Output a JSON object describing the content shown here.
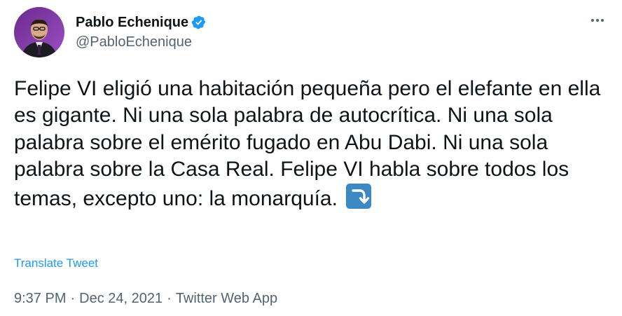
{
  "author": {
    "display_name": "Pablo Echenique",
    "handle": "@PabloEchenique",
    "verified": true,
    "avatar_icon": "profile-photo"
  },
  "tweet": {
    "text": "Felipe VI eligió una habitación pequeña pero el elefante en ella es gigante. Ni una sola palabra de autocrítica. Ni una sola palabra sobre el emérito fugado en Abu Dabi. Ni una sola palabra sobre la Casa Real. Felipe VI habla sobre todos los temas, excepto uno: la monarquía.",
    "emoji": "right-arrow-curving-down",
    "translate_label": "Translate Tweet"
  },
  "meta": {
    "time": "9:37 PM",
    "date": "Dec 24, 2021",
    "source": "Twitter Web App",
    "separator": "·"
  },
  "colors": {
    "text": "#0f1419",
    "secondary": "#536471",
    "link": "#1d9bf0",
    "verified": "#1d9bf0",
    "emoji_bg": "#3b88c3"
  }
}
